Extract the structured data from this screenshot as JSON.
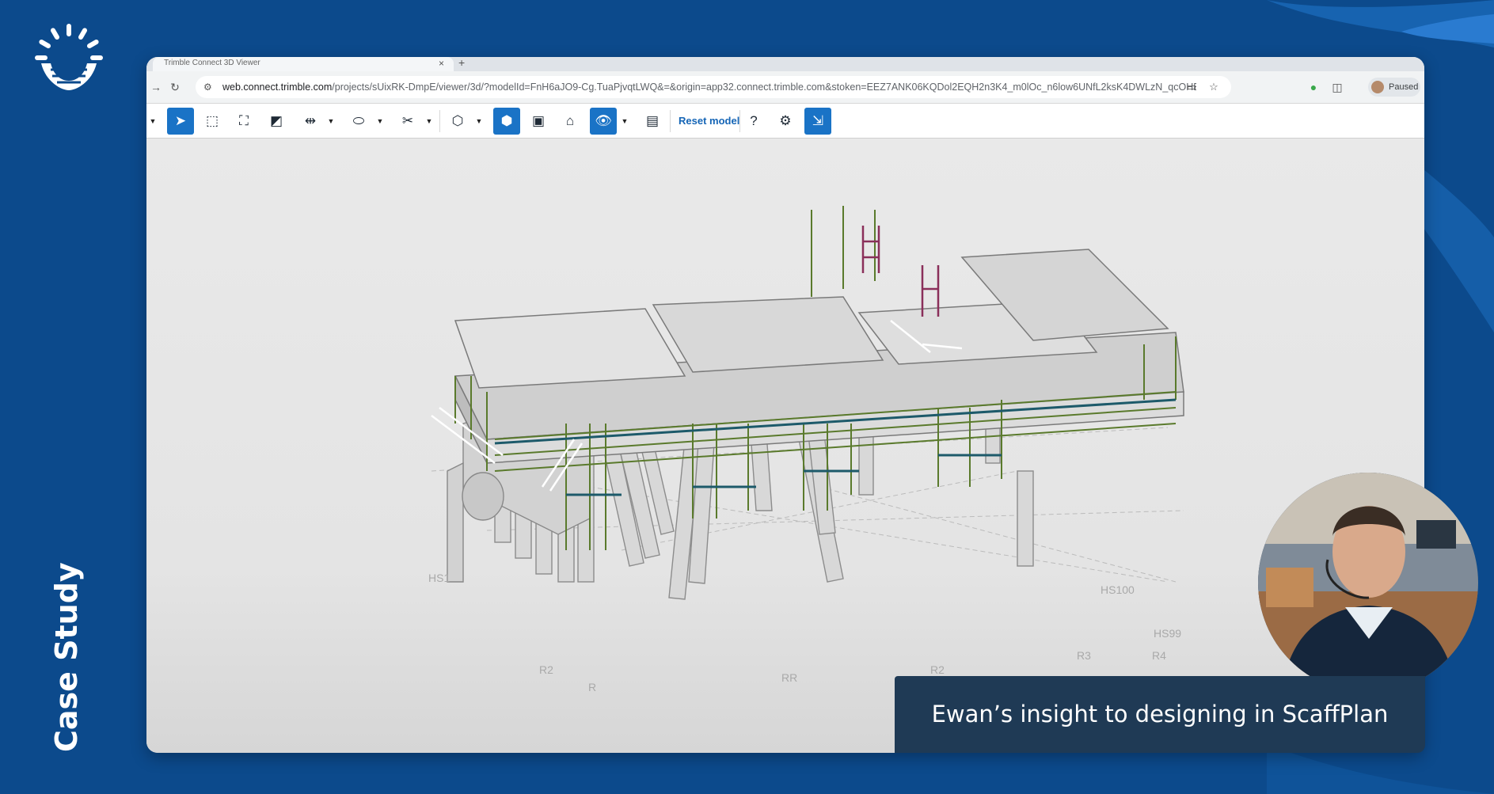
{
  "slide": {
    "side_label": "Case Study",
    "caption": "Ewan’s insight to designing in ScaffPlan",
    "brand_color": "#0c4a8c"
  },
  "browser": {
    "tab_title": "Trimble Connect 3D Viewer",
    "url_host": "web.connect.trimble.com",
    "url_rest": "/projects/sUixRK-DmpE/viewer/3d/?modelId=FnH6aJO9-Cg.TuaPjvqtLWQ&=&origin=app32.connect.trimble.com&stoken=EEZ7ANK06KQDol2EQH2n3K4_m0lOc_n6low6UNfL2ksK4DWLzN_qcOHB9uVQjedL",
    "profile_label": "Paused"
  },
  "toolbar": {
    "reset_label": "Reset model"
  },
  "model": {
    "grid_labels": [
      "HS1",
      "HS100",
      "HS99",
      "R3",
      "R4",
      "R2",
      "RR",
      "R",
      "R2"
    ]
  }
}
